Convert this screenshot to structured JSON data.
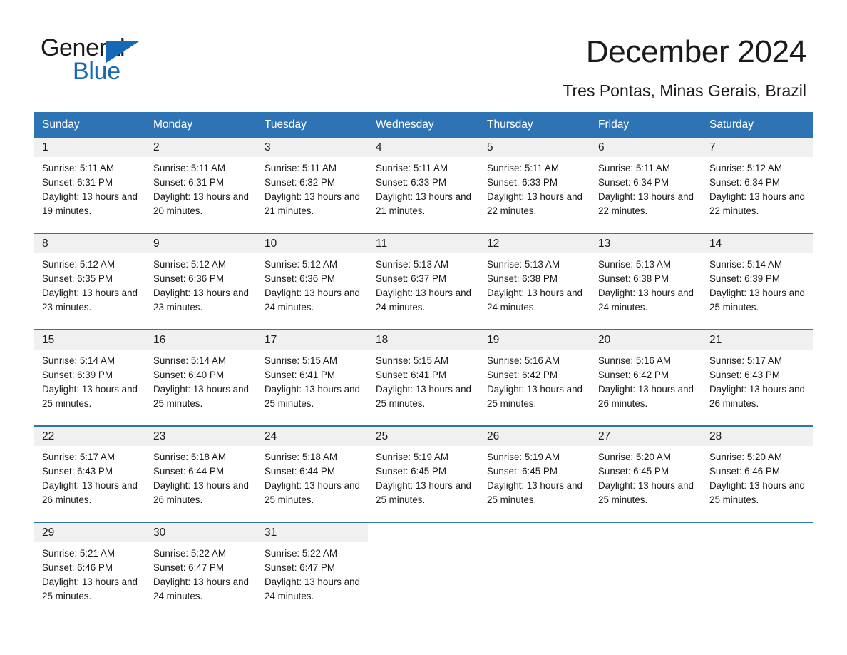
{
  "brand": {
    "name_part1": "General",
    "name_part2": "Blue",
    "triangle_color": "#1569b4",
    "text_color": "#1a1a1a"
  },
  "header": {
    "title": "December 2024",
    "subtitle": "Tres Pontas, Minas Gerais, Brazil"
  },
  "theme": {
    "header_blue": "#2e74b5",
    "daynum_band": "#f0f0f0",
    "text": "#1a1a1a"
  },
  "weekday_headers": [
    "Sunday",
    "Monday",
    "Tuesday",
    "Wednesday",
    "Thursday",
    "Friday",
    "Saturday"
  ],
  "weeks": [
    [
      {
        "day": "1",
        "sunrise": "Sunrise: 5:11 AM",
        "sunset": "Sunset: 6:31 PM",
        "daylight": "Daylight: 13 hours and 19 minutes."
      },
      {
        "day": "2",
        "sunrise": "Sunrise: 5:11 AM",
        "sunset": "Sunset: 6:31 PM",
        "daylight": "Daylight: 13 hours and 20 minutes."
      },
      {
        "day": "3",
        "sunrise": "Sunrise: 5:11 AM",
        "sunset": "Sunset: 6:32 PM",
        "daylight": "Daylight: 13 hours and 21 minutes."
      },
      {
        "day": "4",
        "sunrise": "Sunrise: 5:11 AM",
        "sunset": "Sunset: 6:33 PM",
        "daylight": "Daylight: 13 hours and 21 minutes."
      },
      {
        "day": "5",
        "sunrise": "Sunrise: 5:11 AM",
        "sunset": "Sunset: 6:33 PM",
        "daylight": "Daylight: 13 hours and 22 minutes."
      },
      {
        "day": "6",
        "sunrise": "Sunrise: 5:11 AM",
        "sunset": "Sunset: 6:34 PM",
        "daylight": "Daylight: 13 hours and 22 minutes."
      },
      {
        "day": "7",
        "sunrise": "Sunrise: 5:12 AM",
        "sunset": "Sunset: 6:34 PM",
        "daylight": "Daylight: 13 hours and 22 minutes."
      }
    ],
    [
      {
        "day": "8",
        "sunrise": "Sunrise: 5:12 AM",
        "sunset": "Sunset: 6:35 PM",
        "daylight": "Daylight: 13 hours and 23 minutes."
      },
      {
        "day": "9",
        "sunrise": "Sunrise: 5:12 AM",
        "sunset": "Sunset: 6:36 PM",
        "daylight": "Daylight: 13 hours and 23 minutes."
      },
      {
        "day": "10",
        "sunrise": "Sunrise: 5:12 AM",
        "sunset": "Sunset: 6:36 PM",
        "daylight": "Daylight: 13 hours and 24 minutes."
      },
      {
        "day": "11",
        "sunrise": "Sunrise: 5:13 AM",
        "sunset": "Sunset: 6:37 PM",
        "daylight": "Daylight: 13 hours and 24 minutes."
      },
      {
        "day": "12",
        "sunrise": "Sunrise: 5:13 AM",
        "sunset": "Sunset: 6:38 PM",
        "daylight": "Daylight: 13 hours and 24 minutes."
      },
      {
        "day": "13",
        "sunrise": "Sunrise: 5:13 AM",
        "sunset": "Sunset: 6:38 PM",
        "daylight": "Daylight: 13 hours and 24 minutes."
      },
      {
        "day": "14",
        "sunrise": "Sunrise: 5:14 AM",
        "sunset": "Sunset: 6:39 PM",
        "daylight": "Daylight: 13 hours and 25 minutes."
      }
    ],
    [
      {
        "day": "15",
        "sunrise": "Sunrise: 5:14 AM",
        "sunset": "Sunset: 6:39 PM",
        "daylight": "Daylight: 13 hours and 25 minutes."
      },
      {
        "day": "16",
        "sunrise": "Sunrise: 5:14 AM",
        "sunset": "Sunset: 6:40 PM",
        "daylight": "Daylight: 13 hours and 25 minutes."
      },
      {
        "day": "17",
        "sunrise": "Sunrise: 5:15 AM",
        "sunset": "Sunset: 6:41 PM",
        "daylight": "Daylight: 13 hours and 25 minutes."
      },
      {
        "day": "18",
        "sunrise": "Sunrise: 5:15 AM",
        "sunset": "Sunset: 6:41 PM",
        "daylight": "Daylight: 13 hours and 25 minutes."
      },
      {
        "day": "19",
        "sunrise": "Sunrise: 5:16 AM",
        "sunset": "Sunset: 6:42 PM",
        "daylight": "Daylight: 13 hours and 25 minutes."
      },
      {
        "day": "20",
        "sunrise": "Sunrise: 5:16 AM",
        "sunset": "Sunset: 6:42 PM",
        "daylight": "Daylight: 13 hours and 26 minutes."
      },
      {
        "day": "21",
        "sunrise": "Sunrise: 5:17 AM",
        "sunset": "Sunset: 6:43 PM",
        "daylight": "Daylight: 13 hours and 26 minutes."
      }
    ],
    [
      {
        "day": "22",
        "sunrise": "Sunrise: 5:17 AM",
        "sunset": "Sunset: 6:43 PM",
        "daylight": "Daylight: 13 hours and 26 minutes."
      },
      {
        "day": "23",
        "sunrise": "Sunrise: 5:18 AM",
        "sunset": "Sunset: 6:44 PM",
        "daylight": "Daylight: 13 hours and 26 minutes."
      },
      {
        "day": "24",
        "sunrise": "Sunrise: 5:18 AM",
        "sunset": "Sunset: 6:44 PM",
        "daylight": "Daylight: 13 hours and 25 minutes."
      },
      {
        "day": "25",
        "sunrise": "Sunrise: 5:19 AM",
        "sunset": "Sunset: 6:45 PM",
        "daylight": "Daylight: 13 hours and 25 minutes."
      },
      {
        "day": "26",
        "sunrise": "Sunrise: 5:19 AM",
        "sunset": "Sunset: 6:45 PM",
        "daylight": "Daylight: 13 hours and 25 minutes."
      },
      {
        "day": "27",
        "sunrise": "Sunrise: 5:20 AM",
        "sunset": "Sunset: 6:45 PM",
        "daylight": "Daylight: 13 hours and 25 minutes."
      },
      {
        "day": "28",
        "sunrise": "Sunrise: 5:20 AM",
        "sunset": "Sunset: 6:46 PM",
        "daylight": "Daylight: 13 hours and 25 minutes."
      }
    ],
    [
      {
        "day": "29",
        "sunrise": "Sunrise: 5:21 AM",
        "sunset": "Sunset: 6:46 PM",
        "daylight": "Daylight: 13 hours and 25 minutes."
      },
      {
        "day": "30",
        "sunrise": "Sunrise: 5:22 AM",
        "sunset": "Sunset: 6:47 PM",
        "daylight": "Daylight: 13 hours and 24 minutes."
      },
      {
        "day": "31",
        "sunrise": "Sunrise: 5:22 AM",
        "sunset": "Sunset: 6:47 PM",
        "daylight": "Daylight: 13 hours and 24 minutes."
      },
      {
        "day": "",
        "sunrise": "",
        "sunset": "",
        "daylight": "",
        "blank": true
      },
      {
        "day": "",
        "sunrise": "",
        "sunset": "",
        "daylight": "",
        "blank": true
      },
      {
        "day": "",
        "sunrise": "",
        "sunset": "",
        "daylight": "",
        "blank": true
      },
      {
        "day": "",
        "sunrise": "",
        "sunset": "",
        "daylight": "",
        "blank": true
      }
    ]
  ]
}
